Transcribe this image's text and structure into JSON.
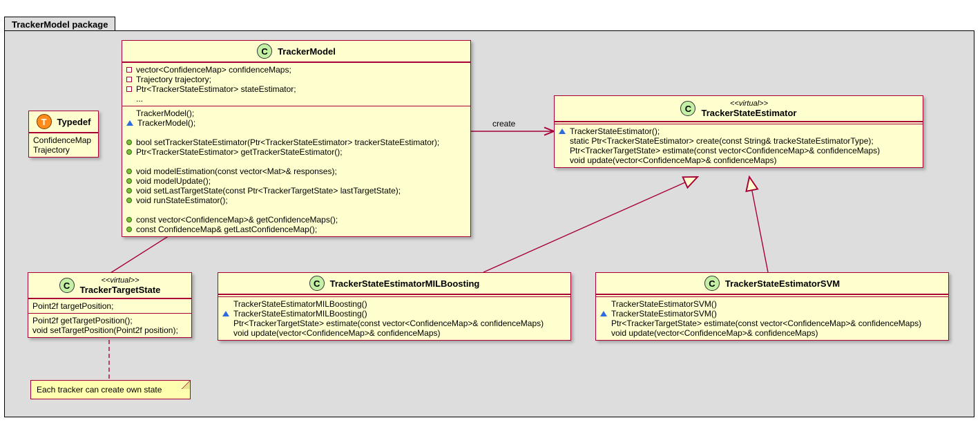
{
  "package_title": "TrackerModel package",
  "create_label": "create",
  "typedef": {
    "badge": "T",
    "title": "Typedef",
    "items": [
      "ConfidenceMap",
      "Trajectory"
    ]
  },
  "tracker_model": {
    "badge": "C",
    "title": "TrackerModel",
    "fields": [
      "vector<ConfidenceMap> confidenceMaps;",
      "Trajectory trajectory;",
      "Ptr<TrackerStateEstimator> stateEstimator;",
      "..."
    ],
    "ctors": [
      "TrackerModel();",
      "TrackerModel();"
    ],
    "set_get_est": [
      "bool setTrackerStateEstimator(Ptr<TrackerStateEstimator> trackerStateEstimator);",
      "Ptr<TrackerStateEstimator> getTrackerStateEstimator();"
    ],
    "model_ops": [
      "void modelEstimation(const vector<Mat>& responses);",
      "void modelUpdate();",
      "void setLastTargetState(const Ptr<TrackerTargetState> lastTargetState);",
      "void runStateEstimator();"
    ],
    "getters": [
      "const vector<ConfidenceMap>& getConfidenceMaps();",
      "const ConfidenceMap& getLastConfidenceMap();"
    ]
  },
  "state_estimator": {
    "badge": "C",
    "stereo": "<<virtual>>",
    "title": "TrackerStateEstimator",
    "lines": [
      "TrackerStateEstimator();",
      "static Ptr<TrackerStateEstimator> create(const String& trackeStateEstimatorType);",
      "Ptr<TrackerTargetState> estimate(const vector<ConfidenceMap>& confidenceMaps)",
      "void update(vector<ConfidenceMap>& confidenceMaps)"
    ]
  },
  "target_state": {
    "badge": "C",
    "stereo": "<<virtual>>",
    "title": "TrackerTargetState",
    "fields": [
      "Point2f targetPosition;"
    ],
    "methods": [
      "Point2f getTargetPosition();",
      "void setTargetPosition(Point2f position);"
    ]
  },
  "mil": {
    "badge": "C",
    "title": "TrackerStateEstimatorMILBoosting",
    "lines": [
      "TrackerStateEstimatorMILBoosting()",
      "TrackerStateEstimatorMILBoosting()",
      "Ptr<TrackerTargetState> estimate(const vector<ConfidenceMap>& confidenceMaps)",
      "void update(vector<ConfidenceMap>& confidenceMaps)"
    ]
  },
  "svm": {
    "badge": "C",
    "title": "TrackerStateEstimatorSVM",
    "lines": [
      "TrackerStateEstimatorSVM()",
      "TrackerStateEstimatorSVM()",
      "Ptr<TrackerTargetState> estimate(const vector<ConfidenceMap>& confidenceMaps)",
      "void update(vector<ConfidenceMap>& confidenceMaps)"
    ]
  },
  "note_text": "Each tracker can create own state"
}
